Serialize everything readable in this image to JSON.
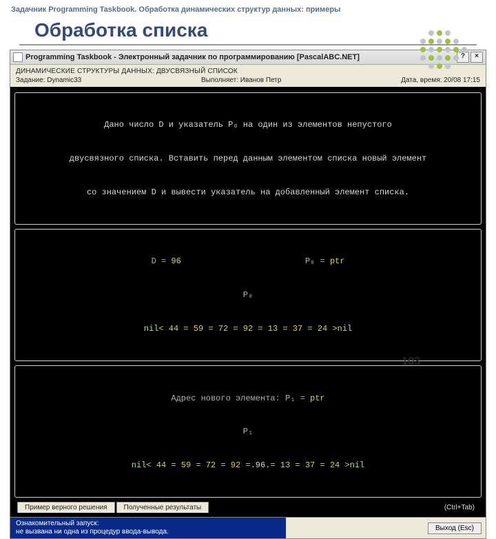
{
  "slide": {
    "header": "Задачник Programming Taskbook. Обработка динамических структур данных: примеры",
    "title": "Обработка списка",
    "page_number": "103"
  },
  "window": {
    "title": "Programming Taskbook - Электронный задачник по программированию [PascalABC.NET]",
    "help_btn": "?",
    "close_btn": "×",
    "meta_heading": "ДИНАМИЧЕСКИЕ СТРУКТУРЫ ДАННЫХ: ДВУСВЯЗНЫЙ СПИСОК",
    "task_label": "Задание: Dynamic33",
    "performer_label": "Выполняет: Иванов Петр",
    "datetime_label": "Дата, время: 20/08 17:15"
  },
  "panels": {
    "task": {
      "l1": "Дано число D и указатель P₀ на один из элементов непустого",
      "l2": "двусвязного списка. Вставить перед данным элементом списка новый элемент",
      "l3": "со значением D и вывести указатель на добавленный элемент списка."
    },
    "input": {
      "d_label": "D = ",
      "d_value": "96",
      "p0_label": "P₀ = ",
      "p0_value": "ptr",
      "p0_line": "P₀",
      "list_prefix": "nil",
      "list_body": "< 44 = 59 = 72 = 92 = 13 = 37 = 24 >",
      "list_suffix": "nil"
    },
    "output": {
      "addr_label": "Адрес нового элемента: P₁ = ",
      "addr_value": "ptr",
      "p1_line": "P₁",
      "list_prefix": "nil",
      "list_left": "< 44 = 59 = 72 = 92 =",
      "insert": ".96.",
      "list_right": "= 13 = 37 = 24 >",
      "list_suffix": "nil"
    }
  },
  "tabs": {
    "tab1": "Пример верного решения",
    "tab2": "Полученные результаты",
    "hint": "(Ctrl+Tab)"
  },
  "status": {
    "line1": "Ознакомительный запуск:",
    "line2": "  не вызвана ни одна из процедур ввода-вывода.",
    "exit_btn": "Выход (Esc)"
  }
}
